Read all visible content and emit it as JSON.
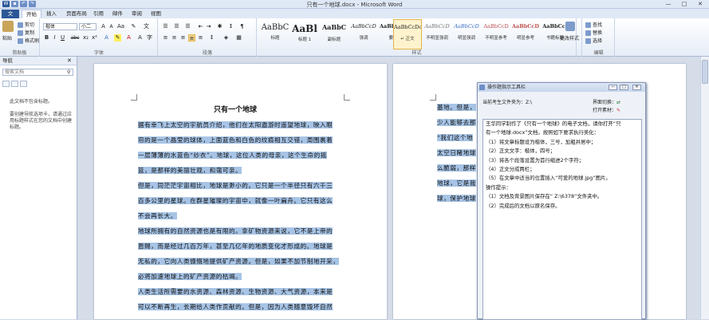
{
  "window": {
    "title": "只有一个地球.docx - Microsoft Word",
    "min": "—",
    "max": "□",
    "close": "✕"
  },
  "tabs": [
    "文件",
    "开始",
    "插入",
    "页面布局",
    "引用",
    "邮件",
    "审阅",
    "视图"
  ],
  "ribbon": {
    "clipboard": {
      "label": "剪贴板",
      "paste": "粘贴",
      "cut": "剪切",
      "copy": "复制",
      "painter": "格式刷"
    },
    "font": {
      "label": "字体",
      "name": "楷体",
      "size": "小二",
      "bold": "B",
      "italic": "I",
      "underline": "U",
      "strike": "abc",
      "sub": "x₂",
      "sup": "x²",
      "color": "A"
    },
    "paragraph": {
      "label": "段落"
    },
    "styles": {
      "label": "样式",
      "items": [
        {
          "sample": "AaBbC",
          "name": "标题"
        },
        {
          "sample": "AaBl",
          "name": "标题 1"
        },
        {
          "sample": "AaBbC",
          "name": "副标题"
        },
        {
          "sample": "AaBbCcD",
          "name": "强调"
        },
        {
          "sample": "AaBbCcD",
          "name": "要点"
        },
        {
          "sample": "AaBbCcDc",
          "name": "↵ 正文"
        },
        {
          "sample": "AaBbCcD",
          "name": "不明显强调"
        },
        {
          "sample": "AaBbCcD",
          "name": "明显强调"
        },
        {
          "sample": "AaBbCcD",
          "name": "不明显参考"
        },
        {
          "sample": "AaBbCcD",
          "name": "明显参考"
        },
        {
          "sample": "AaBbCcI",
          "name": "书籍标题"
        }
      ],
      "change": "更改样式"
    },
    "editing": {
      "label": "编辑",
      "find": "查找",
      "replace": "替换",
      "select": "选择"
    }
  },
  "nav": {
    "title": "导航",
    "search_placeholder": "搜索文档",
    "msg1": "此文档不包含标题。",
    "msg2": "要创建导航选项卡，请通过应用标题样式在您的文档中创建标题。"
  },
  "doc": {
    "title": "只有一个地球",
    "para1": [
      "据有幸飞上太空的宇航员介绍，他们在太阳遨游时遥望地球，映入眼",
      "帘的是一个晶莹的球体，上面蓝色和白色的纹痕相互交错，周围裹着",
      "一层薄薄的水蓝色“纱衣”。地球，这位人类的母亲，这个生命的摇",
      "篮，是那样的美丽壮观，和蔼可亲。"
    ],
    "para2": [
      "但是，同茫茫宇宙相比，地球是渺小的。它只是一个半径只有六千三",
      "百多公里的星球。在群星璀璨的宇宙中，就像一叶扁舟。它只有这么",
      "不会再长大。"
    ],
    "para3": [
      "地球所拥有的自然资源也是有限的。拿矿物资源来说，它不是上帝的",
      "恩赐，而是经过几百万年，甚至几亿年的地质变化才形成的。地球是",
      "无私的，它向人类慷慨地提供矿产资源。但是，如果不加节制地开采，",
      "必将加速地球上的矿产资源的枯竭。"
    ],
    "para4": [
      "人类生活所需要的水资源、森林资源、生物资源、大气资源，本来是",
      "可以不断再生，长期给人类作贡献的。但是，因为人类随意毁坏自然"
    ],
    "page2": [
      "基地。但是，",
      "少人能够去那",
      "“我们这个地",
      "太空日睹地球",
      "么脆弱，那样",
      "地球，它是我",
      "球，保护地球"
    ]
  },
  "panel": {
    "title": "操作题指示工具栏",
    "file_label": "当前考生文件夹为：",
    "file_path": "Z:\\",
    "switch": "界面切换：",
    "open": "打开素材：",
    "lines": [
      "王华同学制作了《只有一个地球》的电子文档，请你打开“只",
      "有一个地球.docx”文档，按照如下要求执行美化：",
      "（1）将文章标题设为楷体，三号，加粗并居中；",
      "（2）正文文字：楷体，四号；",
      "（3）将各个段落设置为首行缩进2个字符；",
      "（4）正文分成两栏；",
      "（5）在文章中适当的位置插入“可爱的地球.jpg”图片。",
      "操作提示：",
      "（1）文档及背景图片保存在“ Z:\\6378”文件夹中。",
      "（2）完成后的文档以原名保存。"
    ]
  }
}
